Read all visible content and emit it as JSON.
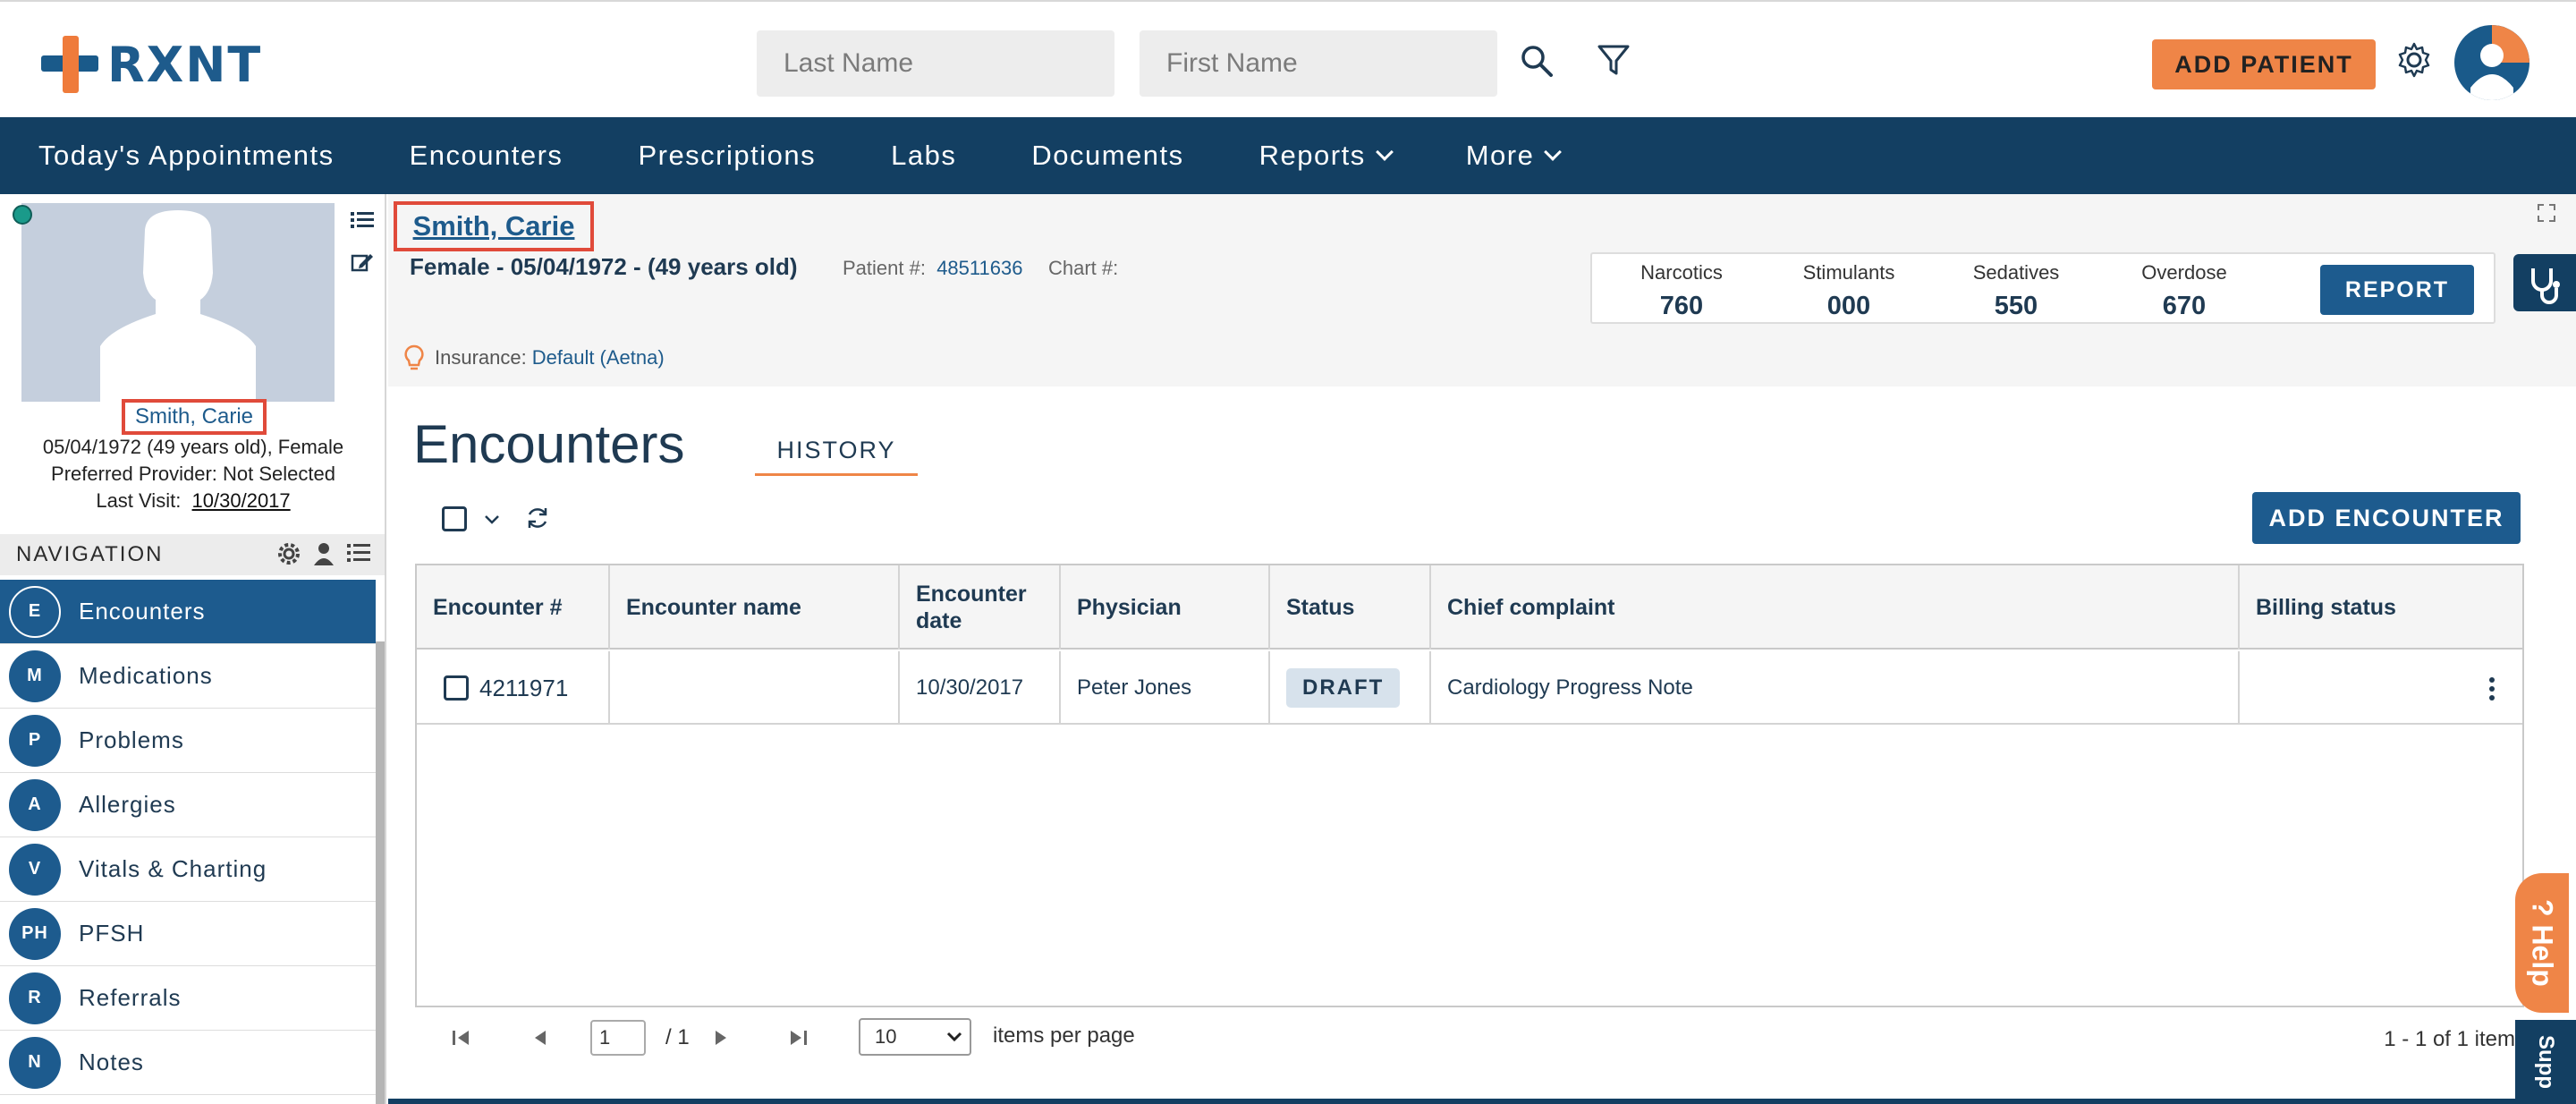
{
  "app": {
    "brand": "RXNT"
  },
  "header": {
    "last_name_placeholder": "Last Name",
    "first_name_placeholder": "First Name",
    "add_patient_label": "ADD PATIENT",
    "icons": [
      "search-icon",
      "filter-icon",
      "gear-icon",
      "avatar"
    ]
  },
  "mainnav": {
    "items": [
      {
        "label": "Today's Appointments"
      },
      {
        "label": "Encounters"
      },
      {
        "label": "Prescriptions"
      },
      {
        "label": "Labs"
      },
      {
        "label": "Documents"
      },
      {
        "label": "Reports"
      },
      {
        "label": "More"
      }
    ]
  },
  "patient": {
    "name": "Smith, Carie",
    "dob_age_gender": "05/04/1972 (49 years old), Female",
    "preferred_provider": "Preferred Provider: Not Selected",
    "last_visit_label": "Last Visit:",
    "last_visit": "10/30/2017",
    "demographics": "Female - 05/04/1972 - (49 years old)",
    "patient_num_label": "Patient #:",
    "patient_num": "48511636",
    "chart_num_label": "Chart #:",
    "insurance_label": "Insurance:",
    "insurance": "Default (Aetna)"
  },
  "pdmp": {
    "items": [
      {
        "label": "Narcotics",
        "value": "760"
      },
      {
        "label": "Stimulants",
        "value": "000"
      },
      {
        "label": "Sedatives",
        "value": "550"
      },
      {
        "label": "Overdose",
        "value": "670"
      }
    ],
    "report_label": "REPORT"
  },
  "sidenav": {
    "title": "NAVIGATION",
    "items": [
      {
        "abbr": "E",
        "label": "Encounters",
        "active": true
      },
      {
        "abbr": "M",
        "label": "Medications"
      },
      {
        "abbr": "P",
        "label": "Problems"
      },
      {
        "abbr": "A",
        "label": "Allergies"
      },
      {
        "abbr": "V",
        "label": "Vitals & Charting"
      },
      {
        "abbr": "PH",
        "label": "PFSH"
      },
      {
        "abbr": "R",
        "label": "Referrals"
      },
      {
        "abbr": "N",
        "label": "Notes"
      }
    ]
  },
  "main": {
    "title": "Encounters",
    "tab_history": "HISTORY",
    "add_encounter_label": "ADD ENCOUNTER",
    "columns": [
      "Encounter #",
      "Encounter name",
      "Encounter date",
      "Physician",
      "Status",
      "Chief complaint",
      "Billing status"
    ],
    "rows": [
      {
        "number": "4211971",
        "name": "",
        "date": "10/30/2017",
        "physician": "Peter Jones",
        "status": "DRAFT",
        "complaint": "Cardiology Progress Note",
        "billing": ""
      }
    ]
  },
  "pager": {
    "page": "1",
    "of": "/ 1",
    "page_size": "10",
    "items_per_page": "items per page",
    "summary": "1 - 1 of 1 items"
  },
  "floating": {
    "help": "? Help",
    "support": "Supp"
  },
  "colors": {
    "navy": "#133f62",
    "blue": "#1d5b8e",
    "orange": "#ef8547",
    "highlight": "#e04a3a"
  }
}
